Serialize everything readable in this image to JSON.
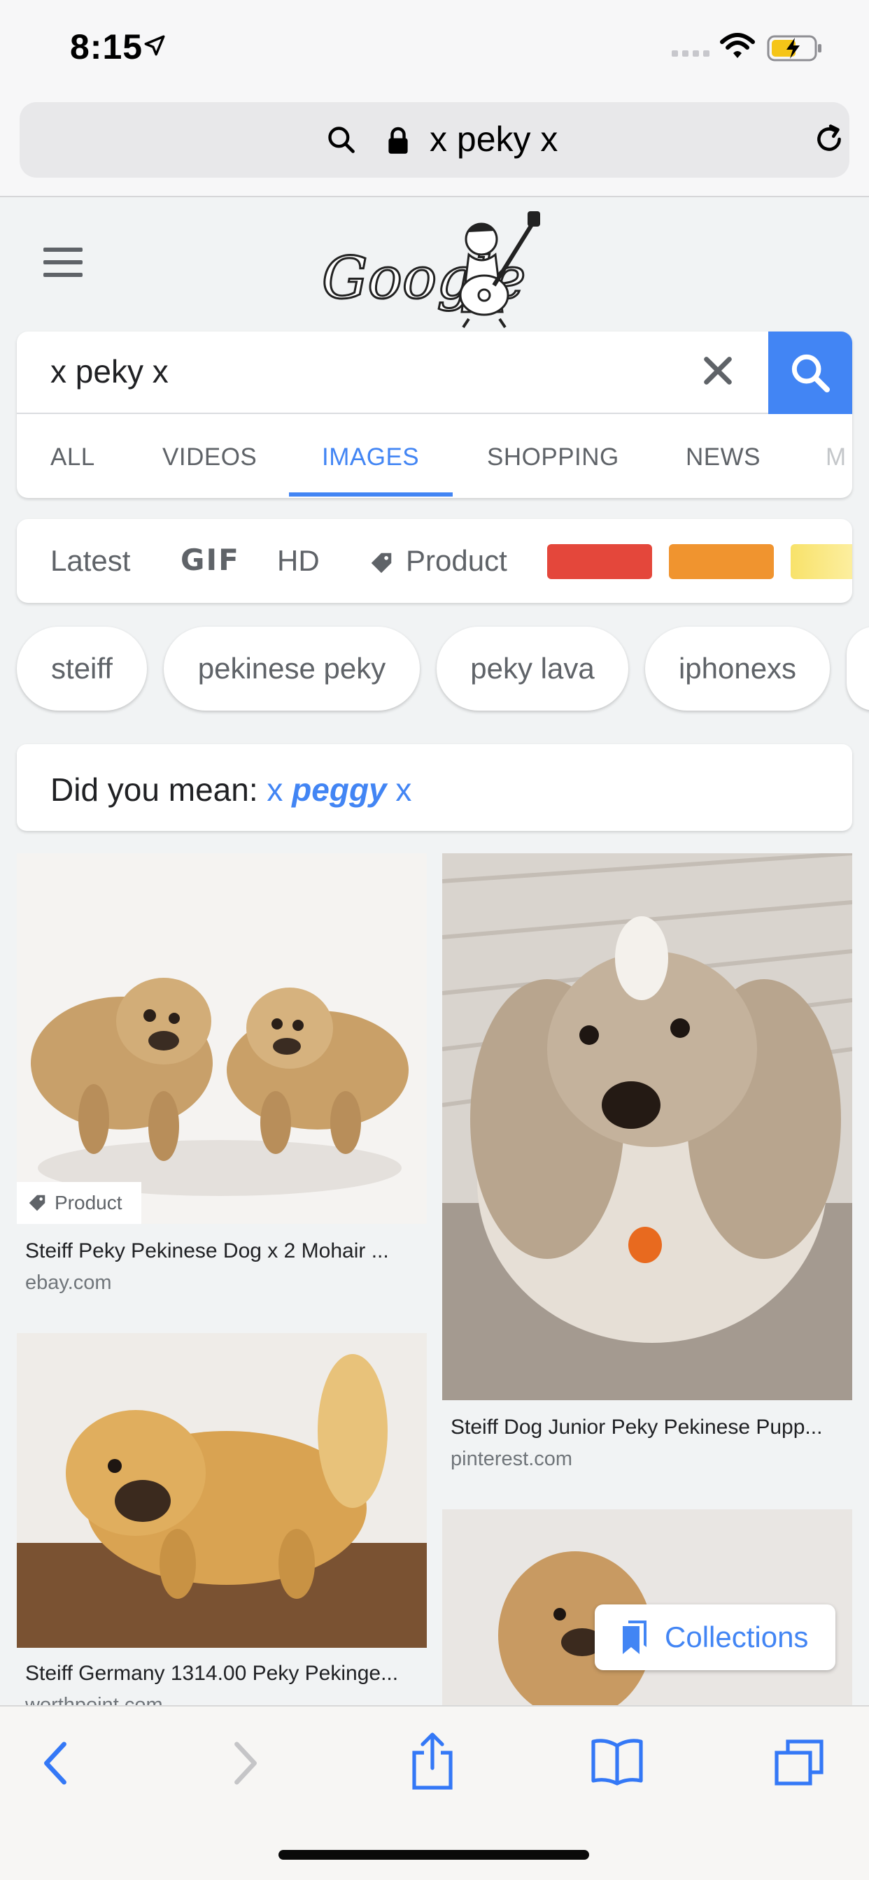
{
  "status_bar": {
    "time": "8:15"
  },
  "url_bar": {
    "text": "x peky x"
  },
  "search": {
    "query": "x peky x"
  },
  "tabs": [
    {
      "label": "ALL"
    },
    {
      "label": "VIDEOS"
    },
    {
      "label": "IMAGES",
      "active": true
    },
    {
      "label": "SHOPPING"
    },
    {
      "label": "NEWS"
    },
    {
      "label": "M"
    }
  ],
  "filters": {
    "latest": "Latest",
    "gif": "GIF",
    "hd": "HD",
    "product": "Product",
    "colors": [
      "#e4473b",
      "#f0942f",
      "#f8e26a"
    ]
  },
  "chips": [
    "steiff",
    "pekinese peky",
    "peky lava",
    "iphonexs"
  ],
  "did_you_mean": {
    "prefix": "Did you mean:",
    "pre": "x",
    "bold": "peggy",
    "post": "x"
  },
  "results": [
    {
      "title": "Steiff Peky Pekinese Dog x 2 Mohair ...",
      "source": "ebay.com",
      "badge": "Product"
    },
    {
      "title": "Steiff Dog Junior Peky Pekinese Pupp...",
      "source": "pinterest.com"
    },
    {
      "title": "Steiff Germany 1314.00 Peky Pekinge...",
      "source": "worthpoint.com"
    },
    {
      "title": "",
      "source": ""
    }
  ],
  "collections": {
    "label": "Collections"
  },
  "toolbar": {
    "icons": [
      "back-icon",
      "forward-icon",
      "share-icon",
      "bookmarks-icon",
      "tabs-icon"
    ]
  }
}
